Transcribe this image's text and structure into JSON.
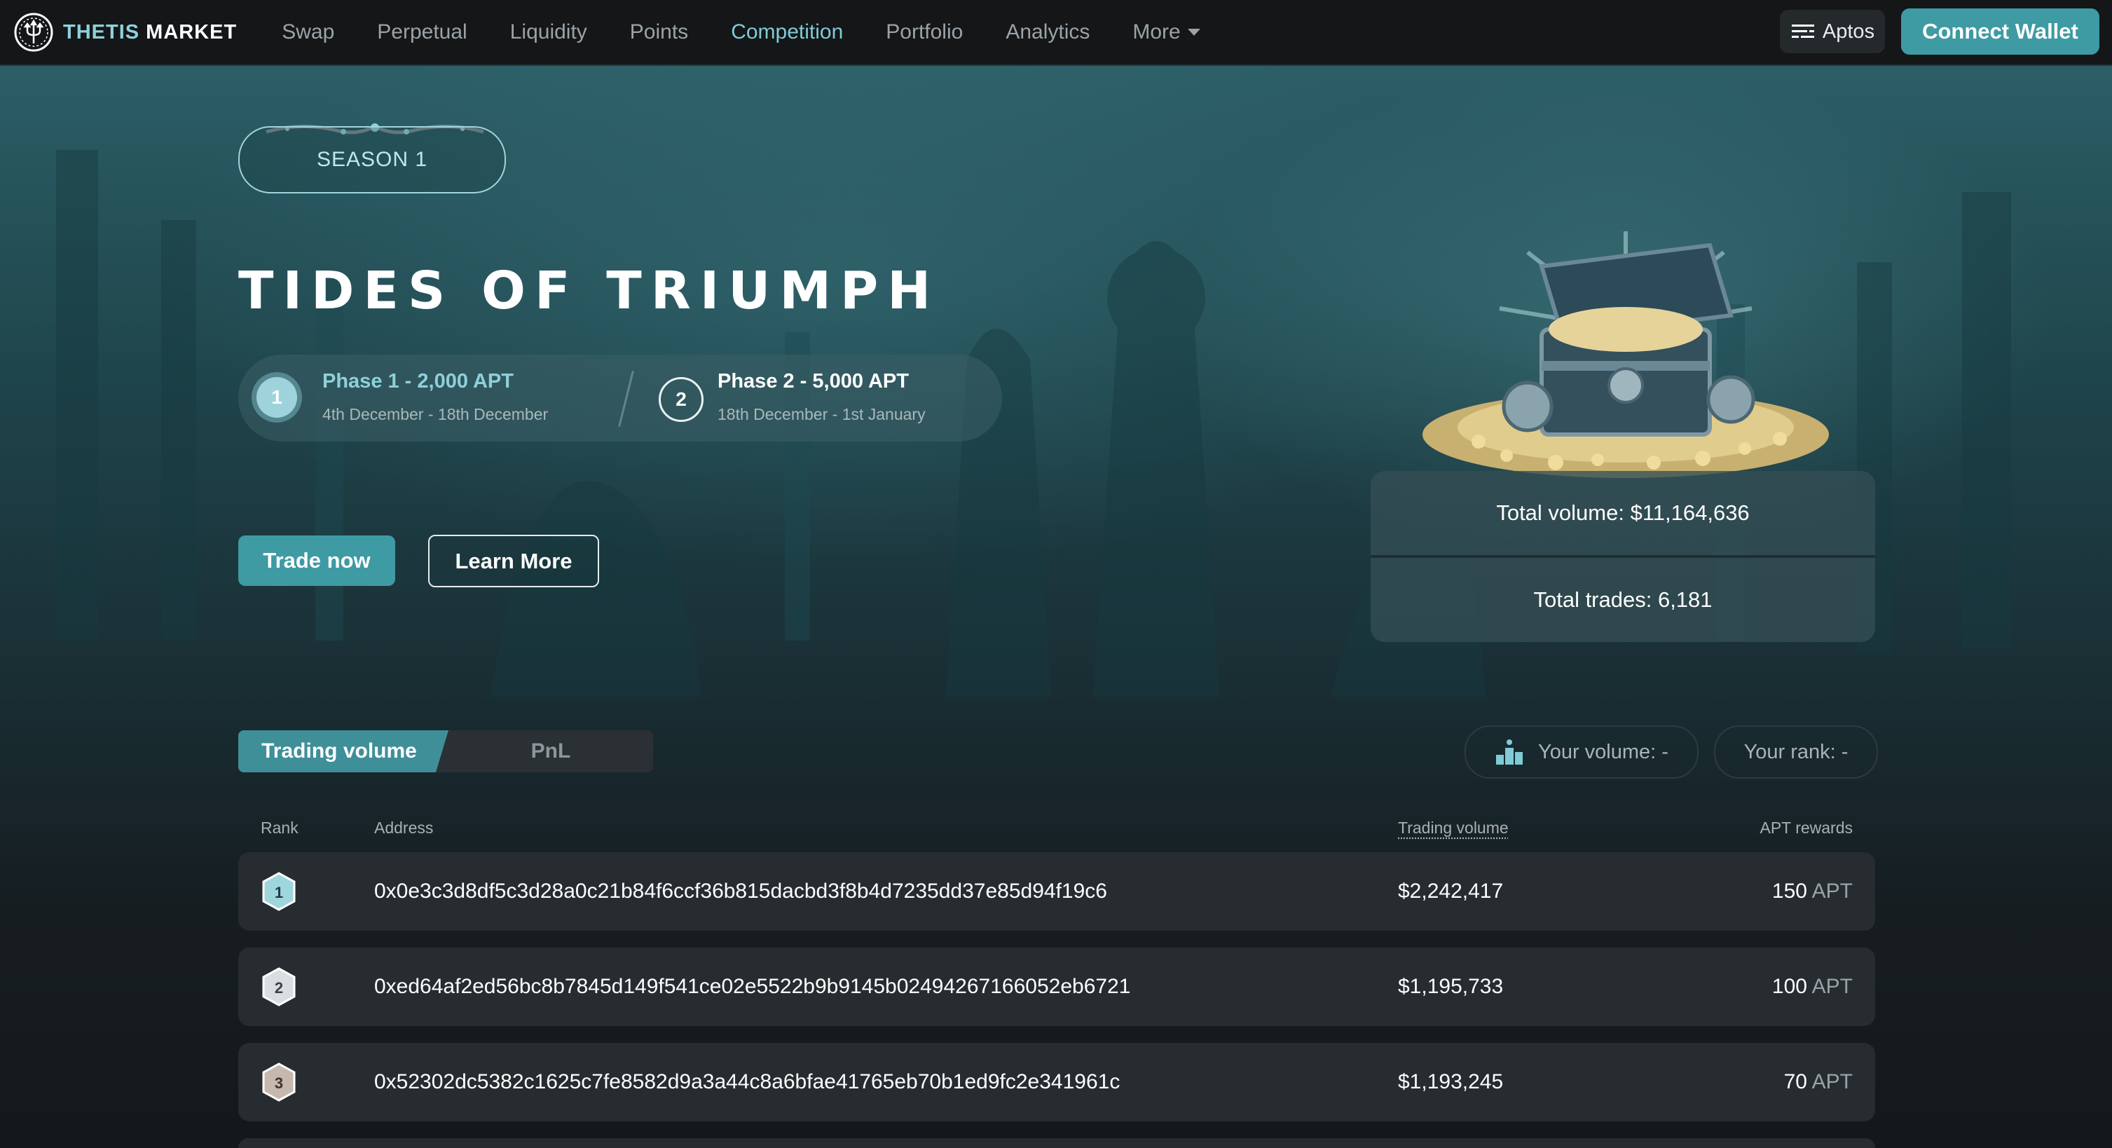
{
  "brand": {
    "name_part1": "THETIS",
    "name_part2": " MARKET"
  },
  "nav": {
    "items": [
      {
        "label": "Swap"
      },
      {
        "label": "Perpetual"
      },
      {
        "label": "Liquidity"
      },
      {
        "label": "Points"
      },
      {
        "label": "Competition",
        "active": true
      },
      {
        "label": "Portfolio"
      },
      {
        "label": "Analytics"
      },
      {
        "label": "More"
      }
    ]
  },
  "network": {
    "label": "Aptos"
  },
  "wallet": {
    "connect_label": "Connect Wallet"
  },
  "hero": {
    "season_label": "SEASON 1",
    "title": "TIDES OF TRIUMPH",
    "phases": [
      {
        "number": "1",
        "title": "Phase 1 - 2,000 APT",
        "dates": "4th December - 18th December"
      },
      {
        "number": "2",
        "title": "Phase 2 - 5,000 APT",
        "dates": "18th December - 1st January"
      }
    ],
    "trade_label": "Trade now",
    "learn_label": "Learn More"
  },
  "stats": {
    "total_volume": "Total volume: $11,164,636",
    "total_trades": "Total trades: 6,181"
  },
  "tabs": {
    "active": "Trading volume",
    "inactive": "PnL"
  },
  "user": {
    "volume": "Your volume: -",
    "rank": "Your rank: -"
  },
  "table": {
    "headers": {
      "rank": "Rank",
      "address": "Address",
      "volume": "Trading volume",
      "rewards": "APT rewards"
    },
    "rows": [
      {
        "rank": "1",
        "address": "0x0e3c3d8df5c3d28a0c21b84f6ccf36b815dacbd3f8b4d7235dd37e85d94f19c6",
        "volume": "$2,242,417",
        "reward": "150",
        "unit": "APT"
      },
      {
        "rank": "2",
        "address": "0xed64af2ed56bc8b7845d149f541ce02e5522b9b9145b02494267166052eb6721",
        "volume": "$1,195,733",
        "reward": "100",
        "unit": "APT"
      },
      {
        "rank": "3",
        "address": "0x52302dc5382c1625c7fe8582d9a3a44c8a6bfae41765eb70b1ed9fc2e341961c",
        "volume": "$1,193,245",
        "reward": "70",
        "unit": "APT"
      }
    ]
  },
  "colors": {
    "accent": "#3e9aa3",
    "accent_text": "#7fcbd6",
    "gold_medal": "#9fd6dd",
    "silver_medal": "#d9dfe1",
    "bronze_medal": "#c7b8ad"
  }
}
